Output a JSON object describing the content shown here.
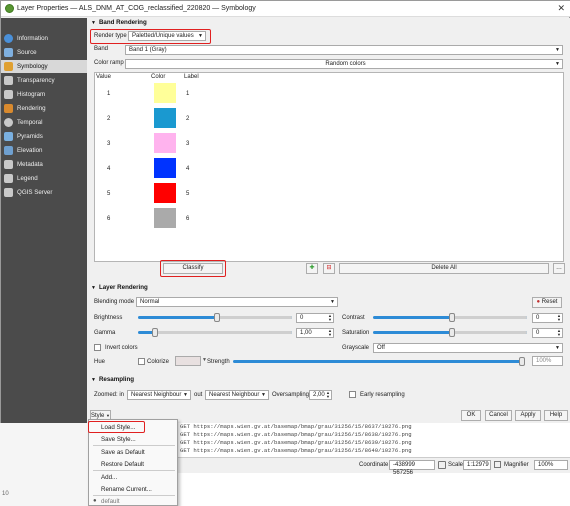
{
  "window": {
    "title": "Layer Properties — ALS_DNM_AT_COG_reclassified_220820 — Symbology",
    "close_glyph": "✕"
  },
  "sidebar": {
    "items": [
      {
        "label": "Information",
        "color": "#4a90d9"
      },
      {
        "label": "Source",
        "color": "#7fb0e0"
      },
      {
        "label": "Symbology",
        "color": "#e0a030"
      },
      {
        "label": "Transparency",
        "color": "#c9c9c9"
      },
      {
        "label": "Histogram",
        "color": "#c9c9c9"
      },
      {
        "label": "Rendering",
        "color": "#d98a2e"
      },
      {
        "label": "Temporal",
        "color": "#c9c9c9"
      },
      {
        "label": "Pyramids",
        "color": "#7ab0e0"
      },
      {
        "label": "Elevation",
        "color": "#6fa0d0"
      },
      {
        "label": "Metadata",
        "color": "#c9c9c9"
      },
      {
        "label": "Legend",
        "color": "#c9c9c9"
      },
      {
        "label": "QGIS Server",
        "color": "#c9c9c9"
      }
    ]
  },
  "band_rendering": {
    "header": "Band Rendering",
    "render_type_label": "Render type",
    "render_type_value": "Paletted/Unique values",
    "band_label": "Band",
    "band_value": "Band 1 (Gray)",
    "color_ramp_label": "Color ramp",
    "color_ramp_value": "Random colors",
    "columns": [
      "Value",
      "Color",
      "Label"
    ],
    "rows": [
      {
        "value": "1",
        "color": "#ffff99",
        "label": "1"
      },
      {
        "value": "2",
        "color": "#1a99d0",
        "label": "2"
      },
      {
        "value": "3",
        "color": "#ffb3ee",
        "label": "3"
      },
      {
        "value": "4",
        "color": "#0033ff",
        "label": "4"
      },
      {
        "value": "5",
        "color": "#ff0000",
        "label": "5"
      },
      {
        "value": "6",
        "color": "#aaaaaa",
        "label": "6"
      }
    ],
    "classify_label": "Classify",
    "add_glyph": "✚",
    "remove_glyph": "⊟",
    "delete_all_label": "Delete All",
    "more_glyph": "…"
  },
  "layer_rendering": {
    "header": "Layer Rendering",
    "blending_mode_label": "Blending mode",
    "blending_mode_value": "Normal",
    "reset_label": "Reset",
    "brightness_label": "Brightness",
    "brightness_value": "0",
    "contrast_label": "Contrast",
    "contrast_value": "0",
    "gamma_label": "Gamma",
    "gamma_value": "1,00",
    "saturation_label": "Saturation",
    "saturation_value": "0",
    "invert_colors_label": "Invert colors",
    "grayscale_label": "Grayscale",
    "grayscale_value": "Off",
    "hue_label": "Hue",
    "colorize_label": "Colorize",
    "strength_label": "Strength",
    "strength_value": "100%"
  },
  "resampling": {
    "header": "Resampling",
    "zoomed_in_label": "Zoomed: in",
    "zoomed_in_value": "Nearest Neighbour",
    "zoomed_out_label": "out",
    "zoomed_out_value": "Nearest Neighbour",
    "oversampling_label": "Oversampling",
    "oversampling_value": "2,00",
    "early_resampling_label": "Early resampling"
  },
  "footer": {
    "style_label": "Style",
    "ok_label": "OK",
    "cancel_label": "Cancel",
    "apply_label": "Apply",
    "help_label": "Help"
  },
  "style_menu": {
    "items": [
      "Load Style...",
      "Save Style...",
      "Save as Default",
      "Restore Default",
      "Add...",
      "Rename Current...",
      "default"
    ]
  },
  "log_lines": [
    "GET https://maps.wien.gv.at/basemap/bmap/grau/31256/15/8637/10276.png",
    "GET https://maps.wien.gv.at/basemap/bmap/grau/31256/15/8638/10276.png",
    "GET https://maps.wien.gv.at/basemap/bmap/grau/31256/15/8639/10276.png",
    "GET https://maps.wien.gv.at/basemap/bmap/grau/31256/15/8640/10276.png"
  ],
  "statusbar": {
    "coordinate_label": "Coordinate",
    "coordinate_value": "-438999 567256",
    "scale_label": "Scale",
    "scale_value": "1:12979",
    "magnifier_label": "Magnifier",
    "magnifier_value": "100%"
  },
  "left_number": "10"
}
